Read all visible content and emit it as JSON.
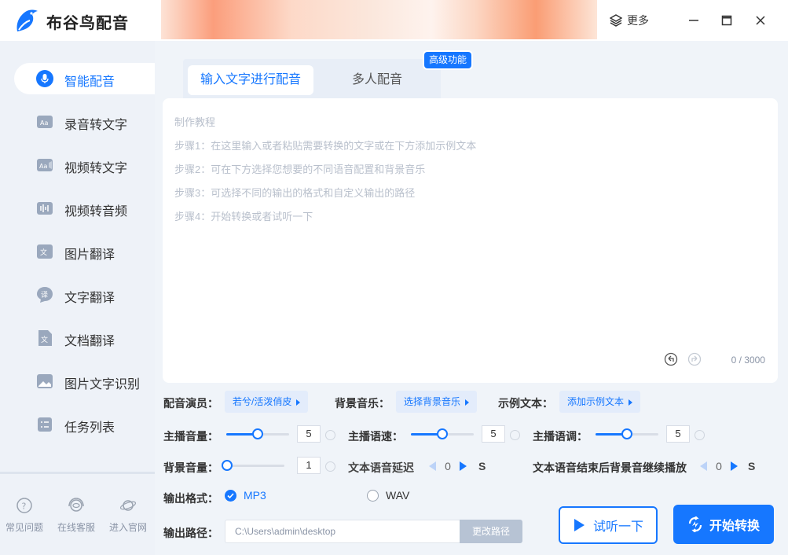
{
  "app": {
    "title": "布谷鸟配音",
    "more_label": "更多"
  },
  "sidebar": {
    "items": [
      {
        "label": "智能配音",
        "icon": "microphone-icon",
        "active": true
      },
      {
        "label": "录音转文字",
        "icon": "audio-text-icon"
      },
      {
        "label": "视频转文字",
        "icon": "video-text-icon"
      },
      {
        "label": "视频转音频",
        "icon": "video-audio-icon"
      },
      {
        "label": "图片翻译",
        "icon": "image-translate-icon"
      },
      {
        "label": "文字翻译",
        "icon": "text-translate-icon"
      },
      {
        "label": "文档翻译",
        "icon": "document-translate-icon"
      },
      {
        "label": "图片文字识别",
        "icon": "image-ocr-icon"
      },
      {
        "label": "任务列表",
        "icon": "task-list-icon"
      }
    ],
    "footer": [
      {
        "label": "常见问题",
        "icon": "question-icon"
      },
      {
        "label": "在线客服",
        "icon": "customer-service-icon"
      },
      {
        "label": "进入官网",
        "icon": "planet-icon"
      }
    ]
  },
  "main": {
    "tabs": [
      {
        "label": "输入文字进行配音",
        "active": true
      },
      {
        "label": "多人配音"
      }
    ],
    "badge": "高级功能",
    "guide": [
      "制作教程",
      "步骤1：在这里输入或者粘贴需要转换的文字或在下方添加示例文本",
      "步骤2：可在下方选择您想要的不同语音配置和背景音乐",
      "步骤3：可选择不同的输出的格式和自定义输出的路径",
      "步骤4：开始转换或者试听一下"
    ],
    "counter": "0 / 3000"
  },
  "controls": {
    "voice_label": "配音演员：",
    "voice_value": "若兮/活泼俏皮",
    "bgm_label": "背景音乐：",
    "bgm_value": "选择背景音乐",
    "sample_label": "示例文本：",
    "sample_value": "添加示例文本",
    "volume_label": "主播音量：",
    "volume_value": "5",
    "volume_fraction": 0.5,
    "speed_label": "主播语速：",
    "speed_value": "5",
    "speed_fraction": 0.5,
    "pitch_label": "主播语调：",
    "pitch_value": "5",
    "pitch_fraction": 0.5,
    "bg_volume_label": "背景音量：",
    "bg_volume_value": "1",
    "bg_volume_fraction": 0.0,
    "delay_label": "文本语音延迟",
    "delay_value": "0",
    "delay_unit": "S",
    "continue_label": "文本语音结束后背景音继续播放",
    "continue_value": "0",
    "continue_unit": "S",
    "format_label": "输出格式：",
    "formats": [
      {
        "label": "MP3",
        "checked": true
      },
      {
        "label": "WAV",
        "checked": false
      }
    ],
    "path_label": "输出路径：",
    "path_value": "C:\\Users\\admin\\desktop",
    "change_path_label": "更改路径",
    "preview_label": "试听一下",
    "start_label": "开始转换"
  },
  "colors": {
    "accent": "#1677ff",
    "sidebar_bg": "#eef2f8",
    "page_bg": "#f0f4f9"
  }
}
